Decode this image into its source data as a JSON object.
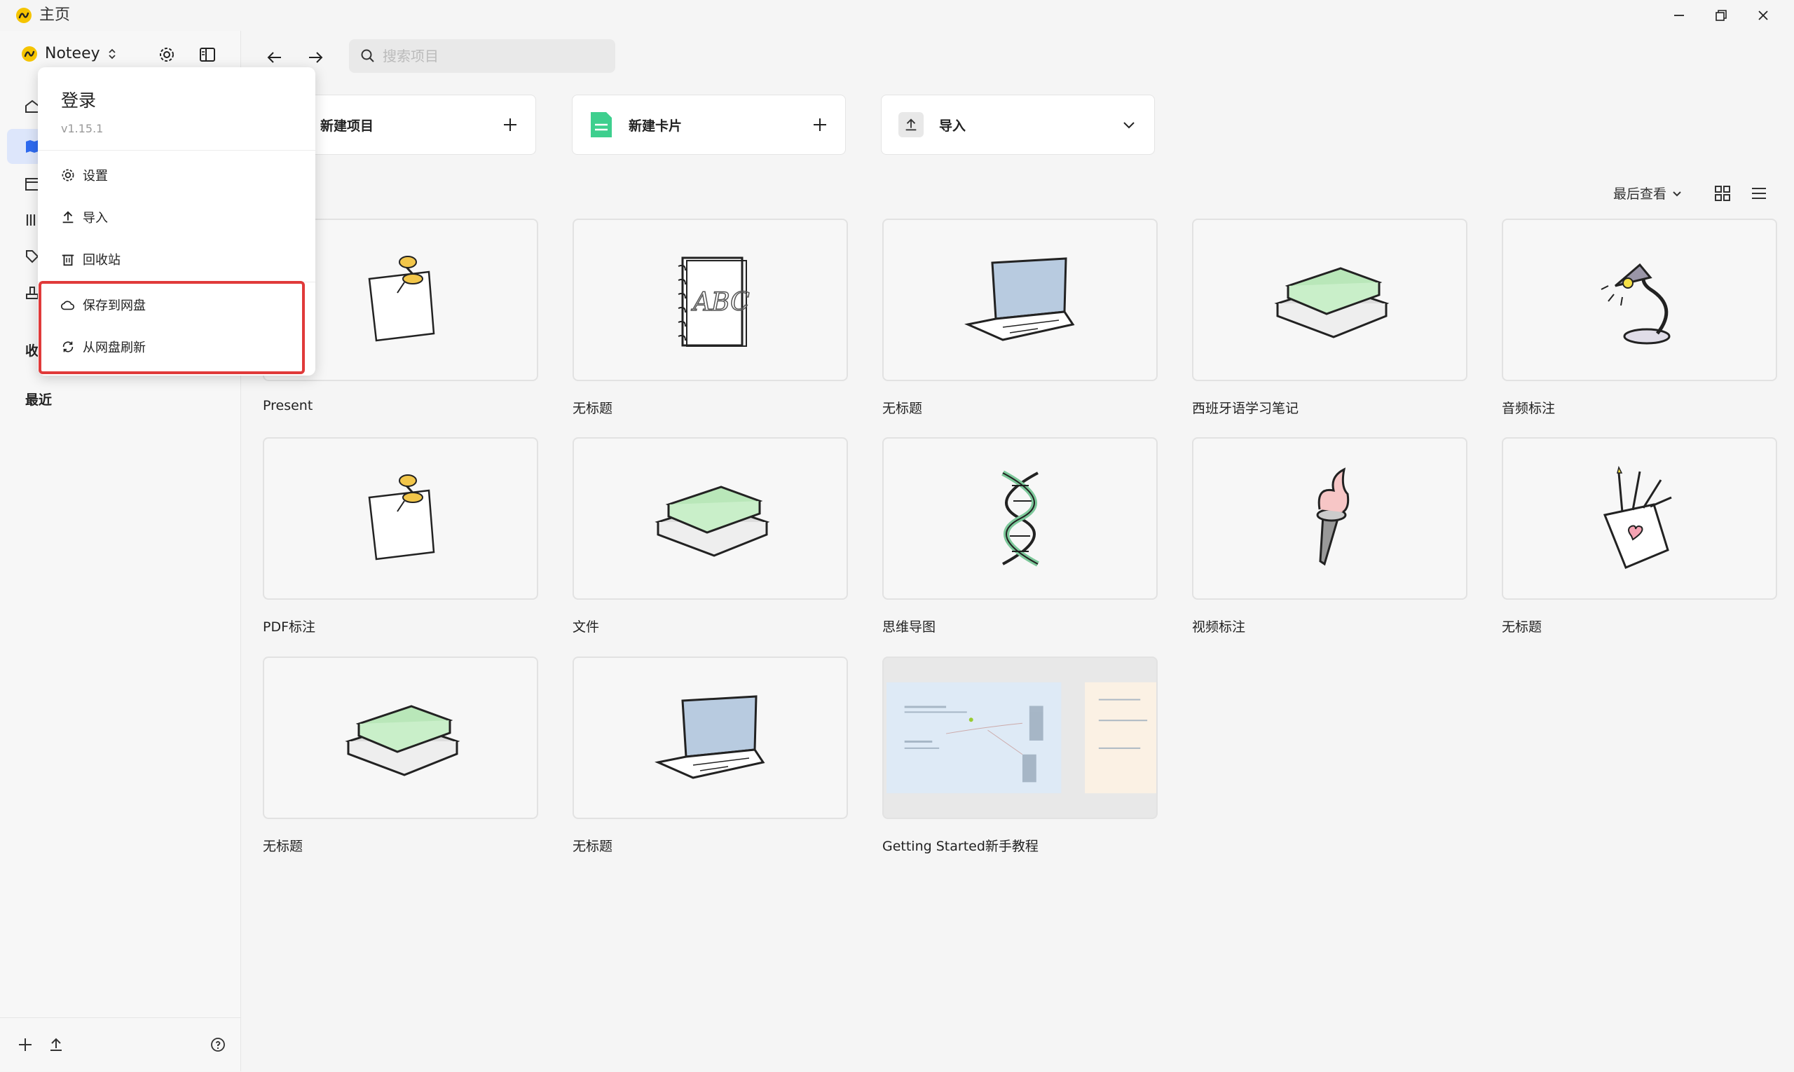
{
  "window": {
    "title": "主页"
  },
  "sidebar": {
    "app_name": "Noteey",
    "section_favorites": "收",
    "section_recent": "最近"
  },
  "menu": {
    "login": "登录",
    "version": "v1.15.1",
    "items": [
      {
        "label": "设置",
        "icon": "gear-icon"
      },
      {
        "label": "导入",
        "icon": "upload-icon"
      },
      {
        "label": "回收站",
        "icon": "trash-icon"
      },
      {
        "label": "保存到网盘",
        "icon": "cloud-icon"
      },
      {
        "label": "从网盘刷新",
        "icon": "refresh-icon"
      }
    ]
  },
  "search": {
    "placeholder": "搜索项目"
  },
  "actions": {
    "new_project": "新建项目",
    "new_card": "新建卡片",
    "import": "导入"
  },
  "toolbar": {
    "sort_label": "最后查看"
  },
  "projects": [
    {
      "title": "Present",
      "thumb": "pushpin-note"
    },
    {
      "title": "无标题",
      "thumb": "abc-notebook"
    },
    {
      "title": "无标题",
      "thumb": "laptop"
    },
    {
      "title": "西班牙语学习笔记",
      "thumb": "books"
    },
    {
      "title": "音频标注",
      "thumb": "desk-lamp"
    },
    {
      "title": "PDF标注",
      "thumb": "pushpin-note"
    },
    {
      "title": "文件",
      "thumb": "books"
    },
    {
      "title": "思维导图",
      "thumb": "dna"
    },
    {
      "title": "视频标注",
      "thumb": "torch"
    },
    {
      "title": "无标题",
      "thumb": "pencil-cup"
    },
    {
      "title": "无标题",
      "thumb": "books"
    },
    {
      "title": "无标题",
      "thumb": "laptop"
    },
    {
      "title": "Getting Started新手教程",
      "thumb": "screenshot-preview"
    }
  ],
  "colors": {
    "accent": "#2f6bf0",
    "highlight": "#e03a3a",
    "brand": "#f5c400",
    "card_green": "#3ecf8e"
  }
}
